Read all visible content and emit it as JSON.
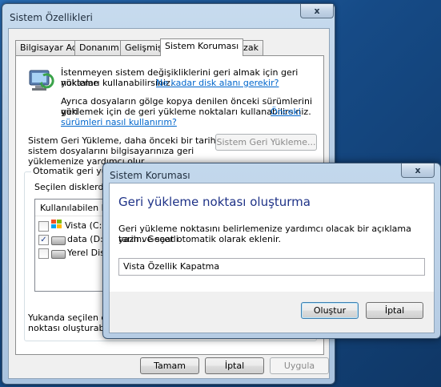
{
  "main_window": {
    "title": "Sistem Özellikleri",
    "close_glyph": "x",
    "tabs": [
      {
        "label": "Bilgisayar Adı"
      },
      {
        "label": "Donanım"
      },
      {
        "label": "Gelişmiş"
      },
      {
        "label": "Sistem Koruması"
      },
      {
        "label": "Uzak"
      }
    ],
    "intro_text_1": "İstenmeyen sistem değişikliklerini geri almak için geri yükleme",
    "intro_text_2": "noktaları kullanabilirsiniz.",
    "intro_link": "Ne kadar disk alanı gerekir?",
    "shadow_text_1": "Ayrıca dosyaların gölge kopya denilen önceki sürümlerini geri",
    "shadow_text_2": "yüklemek için de geri yükleme noktaları kullanabilirsiniz.",
    "shadow_link_1": "Önceki",
    "shadow_link_2": "sürümleri nasıl kullanırım?",
    "restore_text_1": "Sistem Geri Yükleme, daha önceki bir tarihe ait",
    "restore_text_2": "sistem dosyalarını bilgisayarınıza geri",
    "restore_text_3": "yüklemenize yardımcı olur.",
    "restore_button": "Sistem Geri Yükleme...",
    "group_label": "Otomatik geri yükle",
    "select_label": "Seçilen disklerde o",
    "list_header": "Kullanılabilen Disk",
    "drives": [
      {
        "label": "Vista (C:) (",
        "checked": false
      },
      {
        "label": "data (D:)",
        "checked": true
      },
      {
        "label": "Yerel Disk",
        "checked": false
      }
    ],
    "bottom_text_1": "Yukanda seçilen disk",
    "bottom_text_2": "noktası oluşturabilirsin",
    "buttons": {
      "ok": "Tamam",
      "cancel": "İptal",
      "apply": "Uygula"
    }
  },
  "dialog": {
    "title": "Sistem Koruması",
    "close_glyph": "x",
    "heading": "Geri yükleme noktası oluşturma",
    "desc_1": "Geri yükleme noktasını belirlemenize yardımcı olacak bir açıklama yazın. Geçerli",
    "desc_2": "tarih ve saat otomatik olarak eklenir.",
    "input_value": "Vista Özellik Kapatma",
    "create_button": "Oluştur",
    "cancel_button": "İptal"
  },
  "colors": {
    "heading": "#1e3287",
    "link": "#0066cc",
    "frame": "#b6cde5"
  },
  "icons": [
    "system-protection-icon",
    "windows-drive-icon",
    "drive-icon",
    "close-icon"
  ]
}
